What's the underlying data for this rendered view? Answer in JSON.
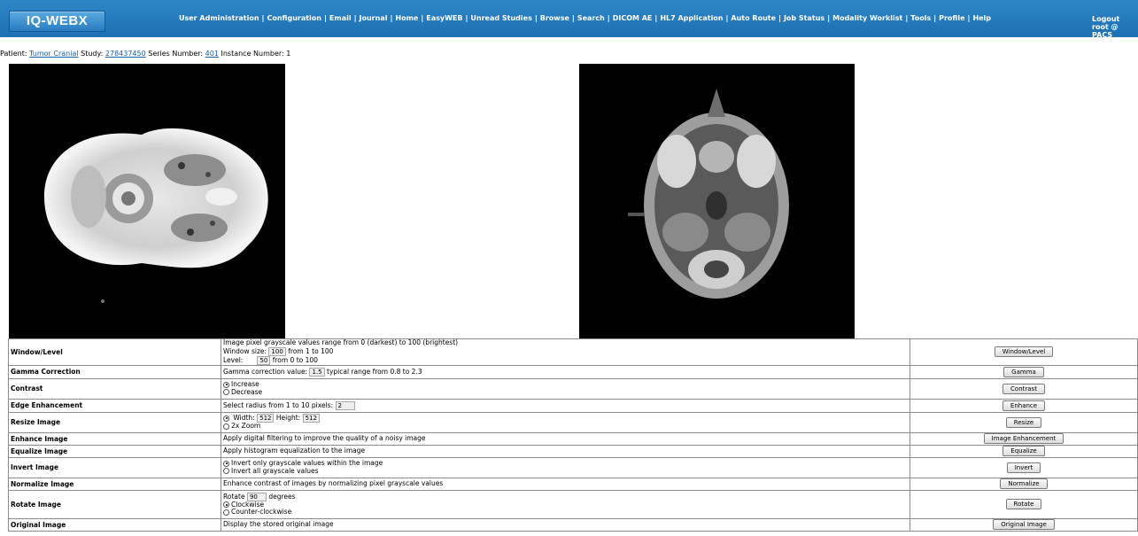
{
  "header": {
    "logo": "IQ-WEBX",
    "nav": [
      "User Administration",
      "Configuration",
      "Email",
      "Journal",
      "Home",
      "EasyWEB",
      "Unread Studies",
      "Browse",
      "Search",
      "DICOM AE",
      "HL7 Application",
      "Auto Route",
      "Job Status",
      "Modality Worklist",
      "Tools",
      "Profile",
      "Help"
    ],
    "logout": "Logout",
    "user": "root @ PACS"
  },
  "patient_line": {
    "patient_label": "Patient:",
    "patient_name": "Tumor Cranial",
    "study_label": "Study:",
    "study_id": "278437450",
    "series_label": "Series Number:",
    "series_number": "401",
    "instance_label": "Instance Number:",
    "instance_number": "1"
  },
  "ops": {
    "window_level": {
      "label": "Window/Level",
      "line1": "Image pixel grayscale values range from 0 (darkest) to 100 (brightest)",
      "size_label": "Window size:",
      "size_value": "100",
      "size_range": "from 1 to 100",
      "level_label": "Level:",
      "level_value": "50",
      "level_range": "from 0 to 100",
      "button": "Window/Level"
    },
    "gamma": {
      "label": "Gamma Correction",
      "prefix": "Gamma correction value:",
      "value": "1.5",
      "suffix": "typical range from 0.8 to 2.3",
      "button": "Gamma"
    },
    "contrast": {
      "label": "Contrast",
      "opt1": "Increase",
      "opt2": "Decrease",
      "button": "Contrast"
    },
    "edge": {
      "label": "Edge Enhancement",
      "prefix": "Select radius from 1 to 10 pixels:",
      "value": "2",
      "button": "Enhance"
    },
    "resize": {
      "label": "Resize Image",
      "width_label": "Width:",
      "width_value": "512",
      "height_label": "Height:",
      "height_value": "512",
      "opt2": "2x Zoom",
      "button": "Resize"
    },
    "enhance": {
      "label": "Enhance Image",
      "desc": "Apply digital filtering to improve the quality of a noisy image",
      "button": "Image Enhancement"
    },
    "equalize": {
      "label": "Equalize Image",
      "desc": "Apply histogram equalization to the image",
      "button": "Equalize"
    },
    "invert": {
      "label": "Invert Image",
      "opt1": "Invert only grayscale values within the image",
      "opt2": "Invert all grayscale values",
      "button": "Invert"
    },
    "normalize": {
      "label": "Normalize Image",
      "desc": "Enhance contrast of images by normalizing pixel grayscale values",
      "button": "Normalize"
    },
    "rotate": {
      "label": "Rotate Image",
      "prefix": "Rotate",
      "value": "90",
      "suffix": "degrees",
      "opt1": "Clockwise",
      "opt2": "Counter-clockwise",
      "button": "Rotate"
    },
    "original": {
      "label": "Original Image",
      "desc": "Display the stored original image",
      "button": "Original Image"
    }
  }
}
